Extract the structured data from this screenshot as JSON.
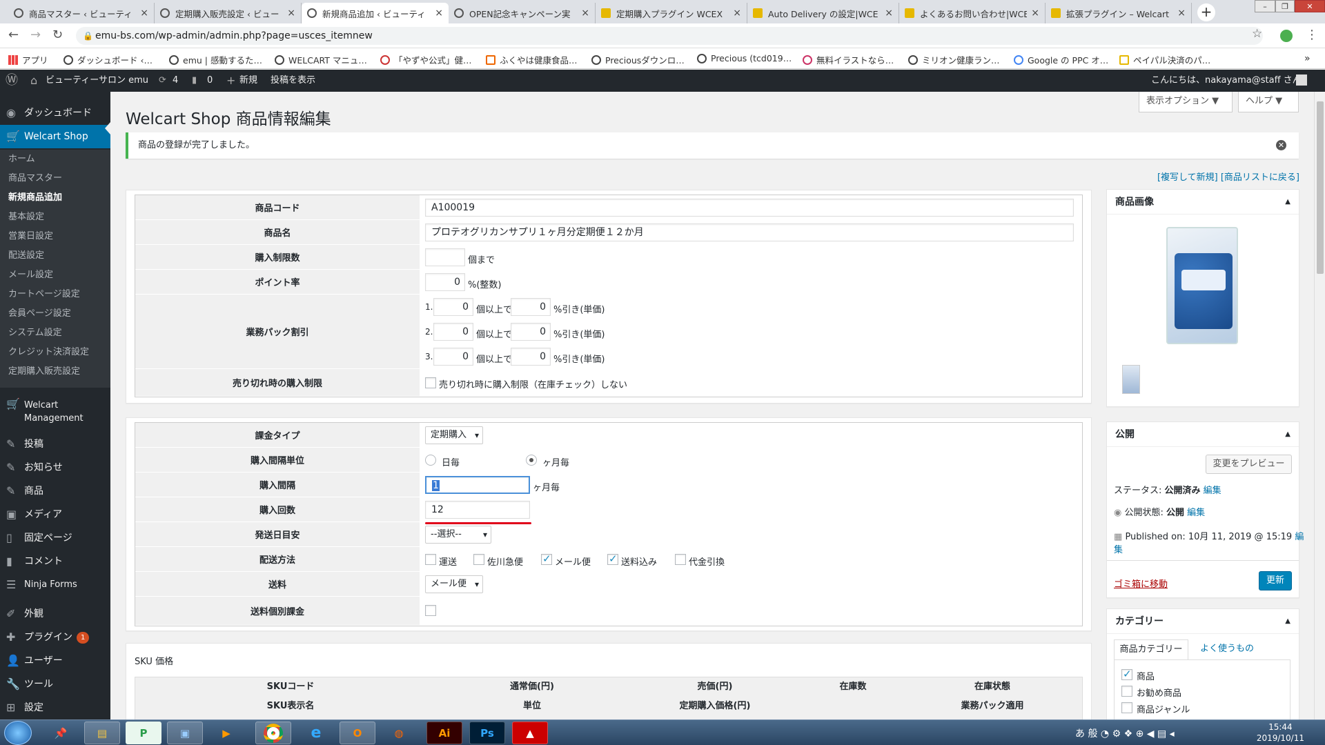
{
  "browser": {
    "tabs": [
      {
        "title": "商品マスター ‹ ビューティ"
      },
      {
        "title": "定期購入販売設定 ‹ ビュー"
      },
      {
        "title": "新規商品追加 ‹ ビューティ"
      },
      {
        "title": "OPEN記念キャンペーン実"
      },
      {
        "title": "定期購入プラグイン WCEX"
      },
      {
        "title": "Auto Delivery の設定|WCE"
      },
      {
        "title": "よくあるお問い合わせ|WCE"
      },
      {
        "title": "拡張プラグイン – Welcart"
      }
    ],
    "url": "emu-bs.com/wp-admin/admin.php?page=usces_itemnew",
    "bookmarks": [
      "アプリ",
      "ダッシュボード ‹…",
      "emu | 感動するた…",
      "WELCART マニュ…",
      "「やずや公式」健…",
      "ふくやは健康食品…",
      "Preciousダウンロ…",
      "Precious (tcd019…",
      "無料イラストなら…",
      "ミリオン健康ラン…",
      "Google の PPC オ…",
      "ペイパル決済のパ…"
    ]
  },
  "adminbar": {
    "site": "ビューティーサロン emu",
    "updates": "4",
    "comments": "0",
    "new": "新規",
    "view": "投稿を表示",
    "greeting": "こんにちは、nakayama@staff さん"
  },
  "sidebar": {
    "dashboard": "ダッシュボード",
    "welcart_shop": "Welcart Shop",
    "subitems": [
      "ホーム",
      "商品マスター",
      "新規商品追加",
      "基本設定",
      "営業日設定",
      "配送設定",
      "メール設定",
      "カートページ設定",
      "会員ページ設定",
      "システム設定",
      "クレジット決済設定",
      "定期購入販売設定"
    ],
    "welcart_mgmt_1": "Welcart",
    "welcart_mgmt_2": "Management",
    "menu": [
      "投稿",
      "お知らせ",
      "商品",
      "メディア",
      "固定ページ",
      "コメント",
      "Ninja Forms",
      "外観",
      "プラグイン",
      "ユーザー",
      "ツール",
      "設定"
    ],
    "plugins_badge": "1"
  },
  "page": {
    "title": "Welcart Shop 商品情報編集",
    "screen_options": "表示オプション ▼",
    "help": "ヘルプ ▼",
    "notice": "商品の登録が完了しました。",
    "links": "[複写して新規] [商品リストに戻る]"
  },
  "basic": {
    "labels": [
      "商品コード",
      "商品名",
      "購入制限数",
      "ポイント率",
      "業務パック割引",
      "売り切れ時の購入制限"
    ],
    "item_code": "A100019",
    "item_name": "プロテオグリカンサプリ１ヶ月分定期便１２か月",
    "limit_unit": "個まで",
    "point_rate": "0",
    "point_unit": "%(整数)",
    "pack_rows": [
      {
        "n": "1.",
        "qty": "0",
        "q_unit": "個以上で",
        "rate": "0",
        "r_unit": "%引き(単価)"
      },
      {
        "n": "2.",
        "qty": "0",
        "q_unit": "個以上で",
        "rate": "0",
        "r_unit": "%引き(単価)"
      },
      {
        "n": "3.",
        "qty": "0",
        "q_unit": "個以上で",
        "rate": "0",
        "r_unit": "%引き(単価)"
      }
    ],
    "soldout_label": "売り切れ時に購入制限（在庫チェック）しない"
  },
  "subscription": {
    "labels": [
      "課金タイプ",
      "購入間隔単位",
      "購入間隔",
      "購入回数",
      "発送日目安",
      "配送方法",
      "送料",
      "送料個別課金"
    ],
    "charge_type": "定期購入",
    "unit_day": "日毎",
    "unit_month": "ヶ月毎",
    "interval": "1",
    "interval_unit": "ヶ月毎",
    "count": "12",
    "ship_date": "--選択--",
    "delivery": [
      {
        "label": "運送",
        "checked": false
      },
      {
        "label": "佐川急便",
        "checked": false
      },
      {
        "label": "メール便",
        "checked": true
      },
      {
        "label": "送料込み",
        "checked": true
      },
      {
        "label": "代金引換",
        "checked": false
      }
    ],
    "shipping": "メール便"
  },
  "sku": {
    "title": "SKU 価格",
    "head1": [
      "SKUコード",
      "通常価(円)",
      "売価(円)",
      "在庫数",
      "在庫状態"
    ],
    "head2": [
      "SKU表示名",
      "単位",
      "定期購入価格(円)",
      "",
      "業務パック適用"
    ]
  },
  "right": {
    "image_box": "商品画像",
    "publish_box": "公開",
    "preview_btn": "変更をプレビュー",
    "status_label": "ステータス: ",
    "status_value": "公開済み",
    "visibility_label": "公開状態: ",
    "visibility_value": "公開",
    "published": "Published on: 10月 11, 2019 @ 15:19",
    "edit": "編集",
    "edit2": "編",
    "edit3": "集",
    "trash": "ゴミ箱に移動",
    "update": "更新",
    "category_box": "カテゴリー",
    "cat_tab1": "商品カテゴリー",
    "cat_tab2": "よく使うもの",
    "categories": [
      {
        "label": "商品",
        "checked": true
      },
      {
        "label": "お勧め商品",
        "checked": false
      },
      {
        "label": "商品ジャンル",
        "checked": false
      }
    ]
  },
  "taskbar": {
    "time": "15:44",
    "date": "2019/10/11"
  }
}
